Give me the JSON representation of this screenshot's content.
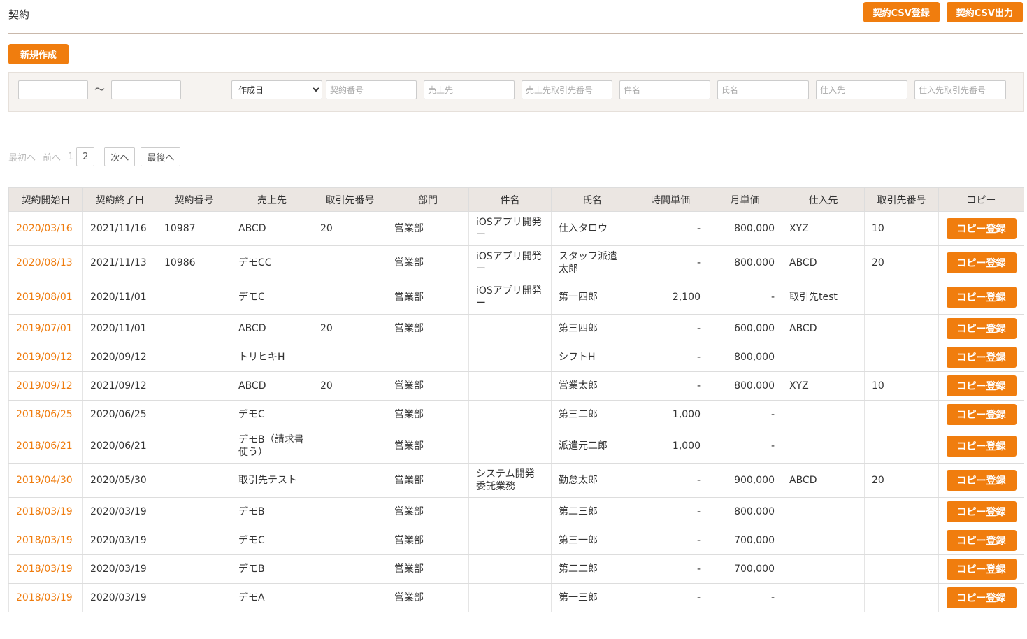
{
  "page_title": "契約",
  "actions": {
    "csv_import": "契約CSV登録",
    "csv_export": "契約CSV出力",
    "new": "新規作成"
  },
  "search": {
    "tilde": "〜",
    "date_type_selected": "作成日",
    "placeholders": {
      "contract_no": "契約番号",
      "customer": "売上先",
      "customer_code": "売上先取引先番号",
      "subject": "件名",
      "name": "氏名",
      "supplier": "仕入先",
      "supplier_code": "仕入先取引先番号"
    }
  },
  "pager": {
    "first": "最初へ",
    "prev": "前へ",
    "page1": "1",
    "page2": "2",
    "next": "次へ",
    "last": "最後へ"
  },
  "columns": [
    "契約開始日",
    "契約終了日",
    "契約番号",
    "売上先",
    "取引先番号",
    "部門",
    "件名",
    "氏名",
    "時間単価",
    "月単価",
    "仕入先",
    "取引先番号",
    "コピー"
  ],
  "copy_label": "コピー登録",
  "rows": [
    {
      "start": "2020/03/16",
      "end": "2021/11/16",
      "no": "10987",
      "customer": "ABCD",
      "cust_code": "20",
      "dept": "営業部",
      "subject": "iOSアプリ開発ー",
      "name": "仕入タロウ",
      "hourly": "-",
      "monthly": "800,000",
      "supplier": "XYZ",
      "sup_code": "10"
    },
    {
      "start": "2020/08/13",
      "end": "2021/11/13",
      "no": "10986",
      "customer": "デモCC",
      "cust_code": "",
      "dept": "営業部",
      "subject": "iOSアプリ開発ー",
      "name": "スタッフ派遣太郎",
      "hourly": "-",
      "monthly": "800,000",
      "supplier": "ABCD",
      "sup_code": "20"
    },
    {
      "start": "2019/08/01",
      "end": "2020/11/01",
      "no": "",
      "customer": "デモC",
      "cust_code": "",
      "dept": "営業部",
      "subject": "iOSアプリ開発ー",
      "name": "第一四郎",
      "hourly": "2,100",
      "monthly": "-",
      "supplier": "取引先test",
      "sup_code": ""
    },
    {
      "start": "2019/07/01",
      "end": "2020/11/01",
      "no": "",
      "customer": "ABCD",
      "cust_code": "20",
      "dept": "営業部",
      "subject": "",
      "name": "第三四郎",
      "hourly": "-",
      "monthly": "600,000",
      "supplier": "ABCD",
      "sup_code": ""
    },
    {
      "start": "2019/09/12",
      "end": "2020/09/12",
      "no": "",
      "customer": "トリヒキH",
      "cust_code": "",
      "dept": "",
      "subject": "",
      "name": "シフトH",
      "hourly": "-",
      "monthly": "800,000",
      "supplier": "",
      "sup_code": ""
    },
    {
      "start": "2019/09/12",
      "end": "2021/09/12",
      "no": "",
      "customer": "ABCD",
      "cust_code": "20",
      "dept": "営業部",
      "subject": "",
      "name": "営業太郎",
      "hourly": "-",
      "monthly": "800,000",
      "supplier": "XYZ",
      "sup_code": "10"
    },
    {
      "start": "2018/06/25",
      "end": "2020/06/25",
      "no": "",
      "customer": "デモC",
      "cust_code": "",
      "dept": "営業部",
      "subject": "",
      "name": "第三二郎",
      "hourly": "1,000",
      "monthly": "-",
      "supplier": "",
      "sup_code": ""
    },
    {
      "start": "2018/06/21",
      "end": "2020/06/21",
      "no": "",
      "customer": "デモB（請求書使う）",
      "cust_code": "",
      "dept": "営業部",
      "subject": "",
      "name": "派遣元二郎",
      "hourly": "1,000",
      "monthly": "-",
      "supplier": "",
      "sup_code": ""
    },
    {
      "start": "2019/04/30",
      "end": "2020/05/30",
      "no": "",
      "customer": "取引先テスト",
      "cust_code": "",
      "dept": "営業部",
      "subject": "システム開発委託業務",
      "name": "勤怠太郎",
      "hourly": "-",
      "monthly": "900,000",
      "supplier": "ABCD",
      "sup_code": "20"
    },
    {
      "start": "2018/03/19",
      "end": "2020/03/19",
      "no": "",
      "customer": "デモB",
      "cust_code": "",
      "dept": "営業部",
      "subject": "",
      "name": "第二三郎",
      "hourly": "-",
      "monthly": "800,000",
      "supplier": "",
      "sup_code": ""
    },
    {
      "start": "2018/03/19",
      "end": "2020/03/19",
      "no": "",
      "customer": "デモC",
      "cust_code": "",
      "dept": "営業部",
      "subject": "",
      "name": "第三一郎",
      "hourly": "-",
      "monthly": "700,000",
      "supplier": "",
      "sup_code": ""
    },
    {
      "start": "2018/03/19",
      "end": "2020/03/19",
      "no": "",
      "customer": "デモB",
      "cust_code": "",
      "dept": "営業部",
      "subject": "",
      "name": "第二二郎",
      "hourly": "-",
      "monthly": "700,000",
      "supplier": "",
      "sup_code": ""
    },
    {
      "start": "2018/03/19",
      "end": "2020/03/19",
      "no": "",
      "customer": "デモA",
      "cust_code": "",
      "dept": "営業部",
      "subject": "",
      "name": "第一三郎",
      "hourly": "-",
      "monthly": "-",
      "supplier": "",
      "sup_code": ""
    }
  ]
}
